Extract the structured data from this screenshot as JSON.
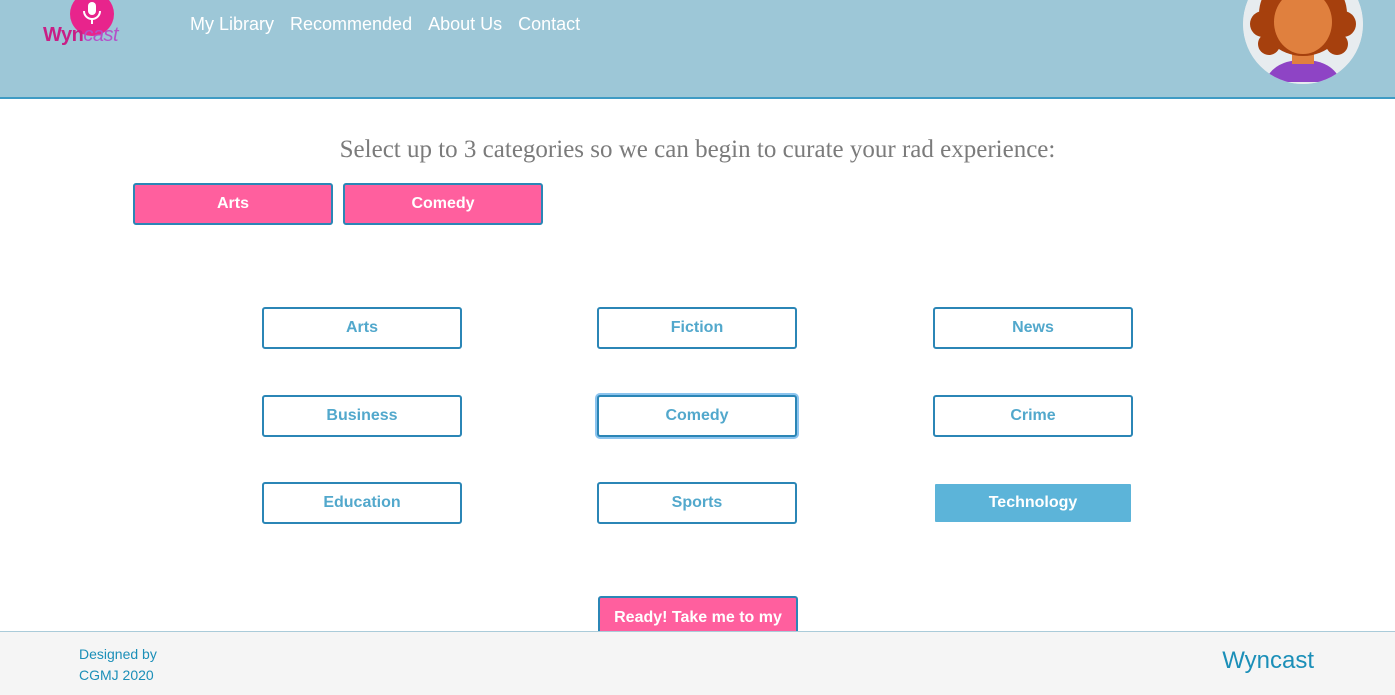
{
  "header": {
    "logo_text_main": "Wyn",
    "logo_text_accent": "cast",
    "nav": [
      {
        "label": "My Library"
      },
      {
        "label": "Recommended"
      },
      {
        "label": "About Us"
      },
      {
        "label": "Contact"
      }
    ]
  },
  "main": {
    "prompt": "Select up to 3 categories so we can begin to curate your rad experience:",
    "selected": [
      "Arts",
      "Comedy"
    ],
    "categories": [
      "Arts",
      "Fiction",
      "News",
      "Business",
      "Comedy",
      "Crime",
      "Education",
      "Sports",
      "Technology"
    ],
    "ready_label": "Ready! Take me to my"
  },
  "footer": {
    "credit": "Designed by CGMJ 2020",
    "brand": "Wyncast"
  },
  "colors": {
    "header_bg": "#9dc7d7",
    "accent_pink": "#ff5f9e",
    "accent_blue": "#2b86b6",
    "category_text": "#52a8cc",
    "filled_category": "#5cb4d9",
    "footer_text": "#1b8fb8"
  },
  "icons": {
    "logo": "podcast-microphone-icon",
    "avatar": "user-avatar"
  }
}
